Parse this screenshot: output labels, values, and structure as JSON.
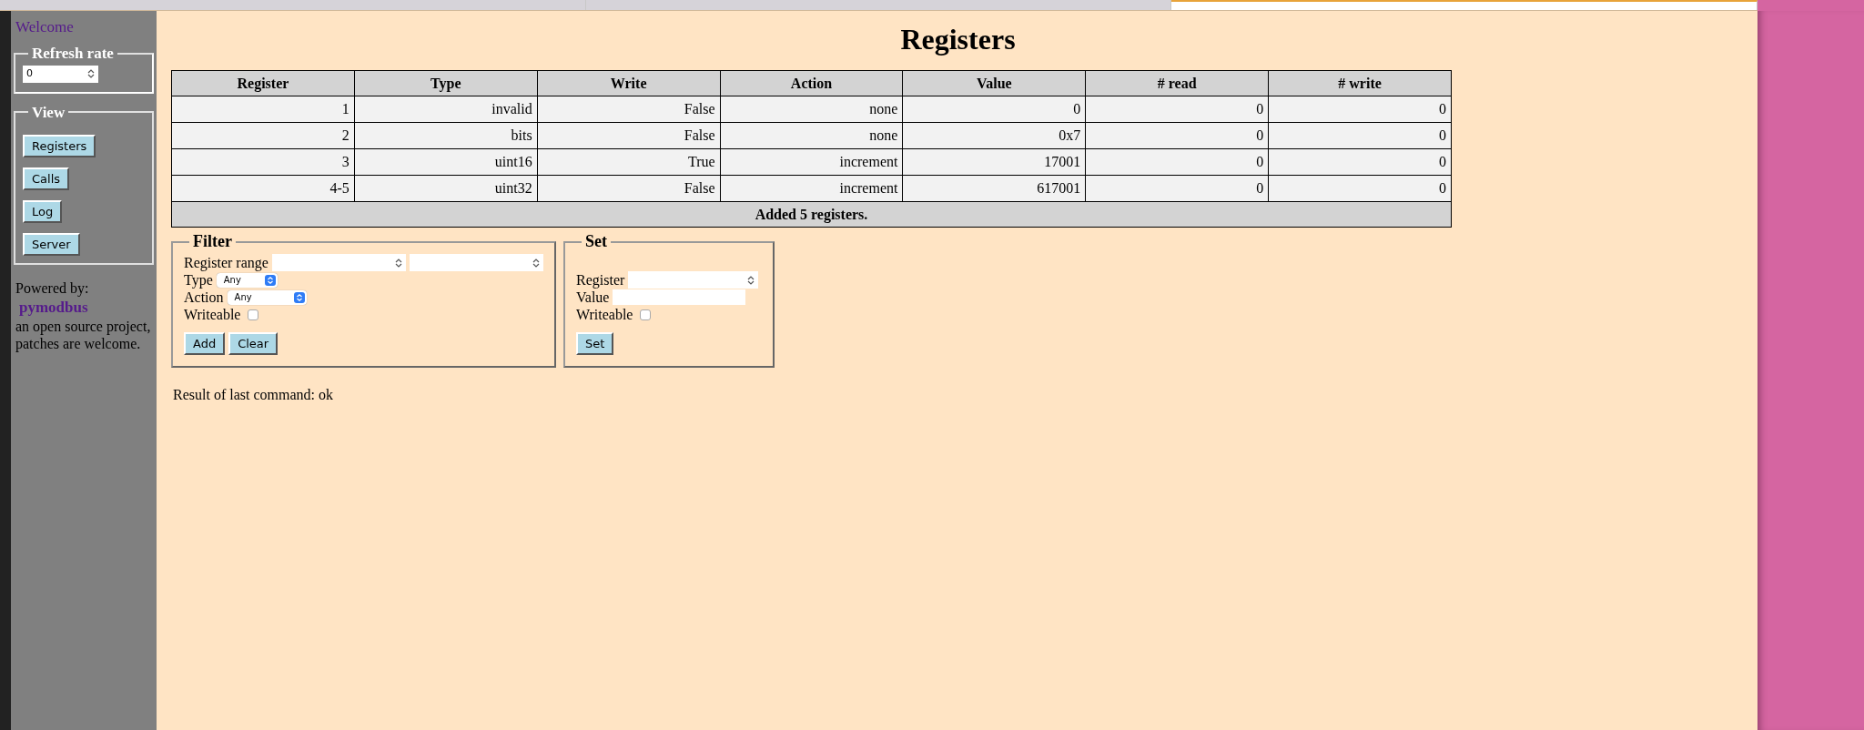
{
  "browser_tabs": [
    {
      "selected": false
    },
    {
      "selected": false
    },
    {
      "selected": true
    }
  ],
  "sidebar": {
    "welcome": "Welcome",
    "refresh_rate": {
      "legend": "Refresh rate",
      "value": "0"
    },
    "view": {
      "legend": "View",
      "buttons": [
        "Registers",
        "Calls",
        "Log",
        "Server"
      ]
    },
    "powered_by": "Powered by:",
    "project_link": "pymodbus",
    "note": "an open source project, patches are welcome."
  },
  "title": "Registers",
  "table": {
    "columns": [
      "Register",
      "Type",
      "Write",
      "Action",
      "Value",
      "# read",
      "# write"
    ],
    "rows": [
      [
        "1",
        "invalid",
        "False",
        "none",
        "0",
        "0",
        "0"
      ],
      [
        "2",
        "bits",
        "False",
        "none",
        "0x7",
        "0",
        "0"
      ],
      [
        "3",
        "uint16",
        "True",
        "increment",
        "17001",
        "0",
        "0"
      ],
      [
        "4-5",
        "uint32",
        "False",
        "increment",
        "617001",
        "0",
        "0"
      ]
    ],
    "footer": "Added 5 registers."
  },
  "filter": {
    "legend": "Filter",
    "register_range": "Register range",
    "type_label": "Type",
    "type_value": "Any",
    "action_label": "Action",
    "action_value": "Any",
    "writeable_label": "Writeable",
    "writeable_checked": false,
    "buttons": [
      "Add",
      "Clear"
    ]
  },
  "set": {
    "legend": "Set",
    "register_label": "Register",
    "value_label": "Value",
    "writeable_label": "Writeable",
    "writeable_checked": false,
    "button": "Set"
  },
  "result": "Result of last command: ok"
}
